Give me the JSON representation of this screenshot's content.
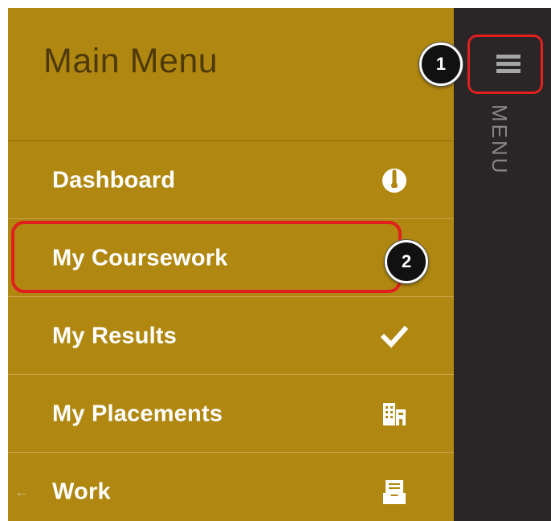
{
  "menu": {
    "title": "Main Menu",
    "vertical_label": "MENU",
    "items": [
      {
        "label": "Dashboard",
        "icon": "dashboard-gauge-icon"
      },
      {
        "label": "My Coursework",
        "icon": ""
      },
      {
        "label": "My Results",
        "icon": "checkmark-icon"
      },
      {
        "label": "My Placements",
        "icon": "building-icon"
      },
      {
        "label": "Work",
        "icon": "inbox-tray-icon",
        "back_arrow": "←"
      }
    ]
  },
  "callouts": {
    "one": "1",
    "two": "2"
  },
  "colors": {
    "menu_bg": "#b08710",
    "rail_bg": "#2a2527",
    "highlight": "#e01f1f"
  }
}
